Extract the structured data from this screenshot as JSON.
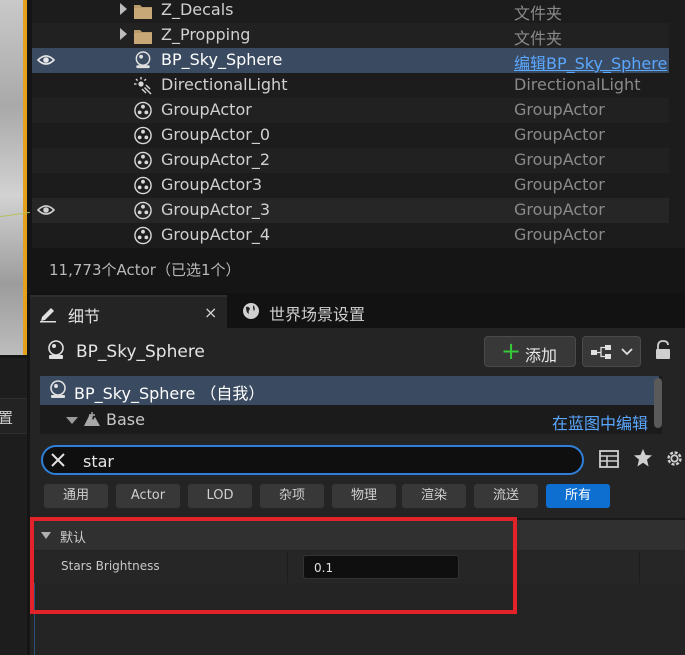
{
  "outliner": {
    "rows": [
      {
        "name": "Z_Decals",
        "type": "文件夹",
        "kind": "folder"
      },
      {
        "name": "Z_Propping",
        "type": "文件夹",
        "kind": "folder"
      },
      {
        "name": "BP_Sky_Sphere",
        "type": "编辑BP_Sky_Sphere",
        "kind": "sphere",
        "selected": true
      },
      {
        "name": "DirectionalLight",
        "type": "DirectionalLight",
        "kind": "light"
      },
      {
        "name": "GroupActor",
        "type": "GroupActor",
        "kind": "group"
      },
      {
        "name": "GroupActor_0",
        "type": "GroupActor",
        "kind": "group"
      },
      {
        "name": "GroupActor_2",
        "type": "GroupActor",
        "kind": "group"
      },
      {
        "name": "GroupActor3",
        "type": "GroupActor",
        "kind": "group"
      },
      {
        "name": "GroupActor_3",
        "type": "GroupActor",
        "kind": "group"
      },
      {
        "name": "GroupActor_4",
        "type": "GroupActor",
        "kind": "group"
      }
    ],
    "actor_count": "11,773个Actor（已选1个）"
  },
  "left_panel": {
    "tab_label": "置"
  },
  "tabs": {
    "details_label": "细节",
    "close_glyph": "×",
    "world_label": "世界场景设置"
  },
  "details": {
    "object_name": "BP_Sky_Sphere",
    "add_label": "添加",
    "add_glyph": "+",
    "components": {
      "self_label": "BP_Sky_Sphere （自我）",
      "base_label": "Base",
      "edit_in_blueprint": "在蓝图中编辑"
    },
    "search": {
      "value": "star"
    },
    "filters": [
      "通用",
      "Actor",
      "LOD",
      "杂项",
      "物理",
      "渲染",
      "流送",
      "所有"
    ],
    "active_filter": "所有",
    "category": "默认",
    "property": {
      "label": "Stars Brightness",
      "value": "0.1"
    }
  },
  "colors": {
    "accent": "#0e6fd1",
    "selection": "#3a4a60",
    "highlight_box": "#e3232a",
    "link": "#5aa7ff"
  }
}
